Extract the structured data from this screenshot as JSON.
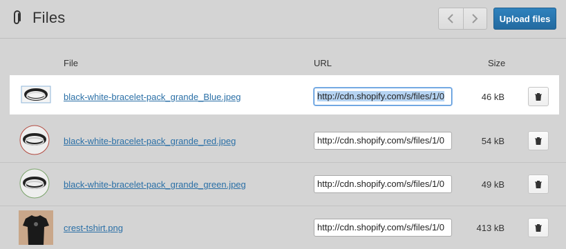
{
  "header": {
    "title": "Files",
    "prev_label": "‹",
    "next_label": "›",
    "upload_label": "Upload files"
  },
  "table": {
    "columns": [
      "File",
      "URL",
      "Size"
    ],
    "rows": [
      {
        "name": "black-white-bracelet-pack_grande_Blue.jpeg",
        "url": "http://cdn.shopify.com/s/files/1/0",
        "size": "46 kB",
        "thumb": "bracelet-icon"
      },
      {
        "name": "black-white-bracelet-pack_grande_red.jpeg",
        "url": "http://cdn.shopify.com/s/files/1/0",
        "size": "54 kB",
        "thumb": "bracelet-icon"
      },
      {
        "name": "black-white-bracelet-pack_grande_green.jpeg",
        "url": "http://cdn.shopify.com/s/files/1/0",
        "size": "49 kB",
        "thumb": "bracelet-icon"
      },
      {
        "name": "crest-tshirt.png",
        "url": "http://cdn.shopify.com/s/files/1/0",
        "size": "413 kB",
        "thumb": "tshirt-icon"
      }
    ]
  },
  "colors": {
    "background": "#d4d4d4",
    "accent": "#2a6fa6",
    "selected_row": "#ffffff"
  }
}
